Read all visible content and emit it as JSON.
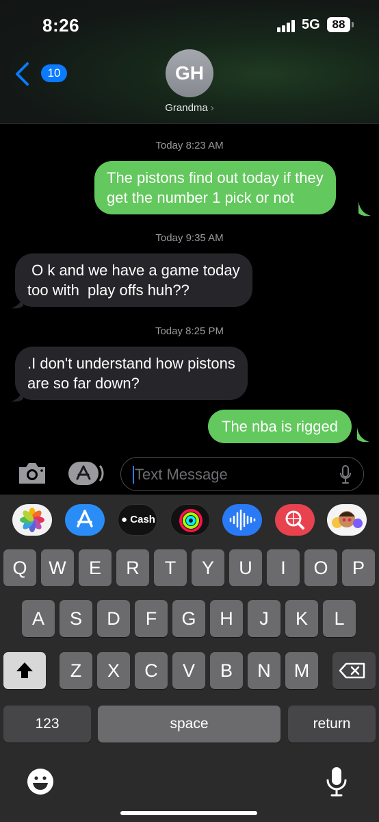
{
  "status_bar": {
    "time": "8:26",
    "network": "5G",
    "battery": "88"
  },
  "header": {
    "back_badge": "10",
    "avatar_initials": "GH",
    "contact_name": "Grandma",
    "contact_chevron": "›"
  },
  "messages": [
    {
      "timestamp": "Today 8:23 AM"
    },
    {
      "direction": "outgoing",
      "text": "The pistons find out today if they\nget the number 1 pick or not"
    },
    {
      "timestamp": "Today 9:35 AM"
    },
    {
      "direction": "incoming",
      "text": " O k and we have a game today\ntoo with  play offs huh??"
    },
    {
      "timestamp": "Today 8:25 PM"
    },
    {
      "direction": "incoming",
      "text": ".I don't understand how pistons\nare so far down?"
    },
    {
      "direction": "outgoing",
      "text": "The nba is rigged"
    }
  ],
  "compose": {
    "placeholder": "Text Message"
  },
  "app_strip": [
    {
      "icon": "photos-icon"
    },
    {
      "icon": "app-store-icon"
    },
    {
      "icon": "apple-cash-icon",
      "label": "Cash"
    },
    {
      "icon": "activity-icon"
    },
    {
      "icon": "audio-message-icon"
    },
    {
      "icon": "image-search-icon"
    },
    {
      "icon": "memoji-icon"
    }
  ],
  "keyboard": {
    "row1": [
      "Q",
      "W",
      "E",
      "R",
      "T",
      "Y",
      "U",
      "I",
      "O",
      "P"
    ],
    "row2": [
      "A",
      "S",
      "D",
      "F",
      "G",
      "H",
      "J",
      "K",
      "L"
    ],
    "row3": [
      "Z",
      "X",
      "C",
      "V",
      "B",
      "N",
      "M"
    ],
    "numbers_key": "123",
    "space_key": "space",
    "return_key": "return"
  },
  "colors": {
    "outgoing_bubble": "#63c85d",
    "incoming_bubble": "#26262a",
    "accent_blue": "#0a7aff"
  }
}
